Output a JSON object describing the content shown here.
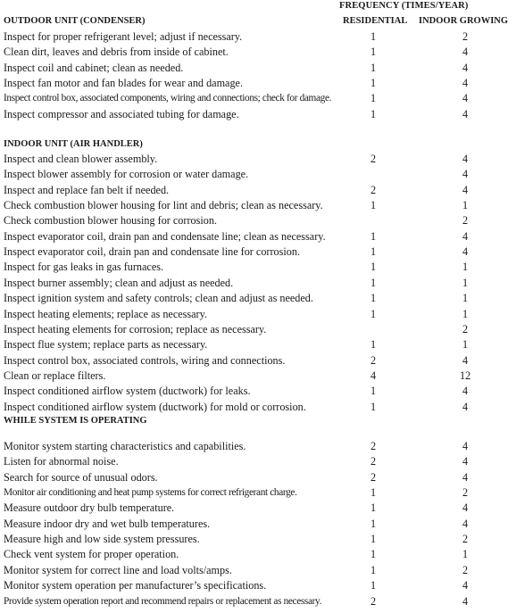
{
  "header": {
    "frequency_title": "FREQUENCY (TIMES/YEAR)",
    "col_residential": "RESIDENTIAL",
    "col_indoor_growing": "INDOOR GROWING"
  },
  "sections": [
    {
      "title": "OUTDOOR UNIT (CONDENSER)",
      "rows": [
        {
          "task": "Inspect for proper refrigerant level; adjust if necessary.",
          "residential": "1",
          "indoor_growing": "2"
        },
        {
          "task": "Clean dirt, leaves and debris from inside of cabinet.",
          "residential": "1",
          "indoor_growing": "4"
        },
        {
          "task": "Inspect coil and cabinet; clean as needed.",
          "residential": "1",
          "indoor_growing": "4"
        },
        {
          "task": "Inspect fan motor and fan blades for wear and damage.",
          "residential": "1",
          "indoor_growing": "4"
        },
        {
          "task": "Inspect control box, associated components, wiring and connections; check for damage.",
          "residential": "1",
          "indoor_growing": "4"
        },
        {
          "task": "Inspect compressor and associated tubing for damage.",
          "residential": "1",
          "indoor_growing": "4"
        }
      ]
    },
    {
      "title": "INDOOR UNIT (AIR HANDLER)",
      "rows": [
        {
          "task": "Inspect and clean blower assembly.",
          "residential": "2",
          "indoor_growing": "4"
        },
        {
          "task": "Inspect blower assembly for corrosion or water damage.",
          "residential": "",
          "indoor_growing": "4"
        },
        {
          "task": "Inspect and replace fan belt if needed.",
          "residential": "2",
          "indoor_growing": "4"
        },
        {
          "task": "Check combustion blower housing for lint and debris; clean as necessary.",
          "residential": "1",
          "indoor_growing": "1"
        },
        {
          "task": "Check combustion blower housing for corrosion.",
          "residential": "",
          "indoor_growing": "2"
        },
        {
          "task": "Inspect evaporator coil, drain pan and condensate line; clean as necessary.",
          "residential": "1",
          "indoor_growing": "4"
        },
        {
          "task": "Inspect evaporator coil, drain pan and condensate line for corrosion.",
          "residential": "1",
          "indoor_growing": "4"
        },
        {
          "task": "Inspect for gas leaks in gas furnaces.",
          "residential": "1",
          "indoor_growing": "1"
        },
        {
          "task": "Inspect burner assembly; clean and adjust as needed.",
          "residential": "1",
          "indoor_growing": "1"
        },
        {
          "task": "Inspect ignition system and safety controls; clean and adjust as needed.",
          "residential": "1",
          "indoor_growing": "1"
        },
        {
          "task": "Inspect heating elements; replace as necessary.",
          "residential": "1",
          "indoor_growing": "1"
        },
        {
          "task": "Inspect heating elements for corrosion; replace as necessary.",
          "residential": "",
          "indoor_growing": "2"
        },
        {
          "task": "Inspect flue system; replace parts as necessary.",
          "residential": "1",
          "indoor_growing": "1"
        },
        {
          "task": "Inspect control box, associated controls, wiring and connections.",
          "residential": "2",
          "indoor_growing": "4"
        },
        {
          "task": "Clean or replace filters.",
          "residential": "4",
          "indoor_growing": "12"
        },
        {
          "task": "Inspect conditioned airflow system (ductwork) for leaks.",
          "residential": "1",
          "indoor_growing": "4"
        },
        {
          "task": "Inspect conditioned airflow system (ductwork) for mold or corrosion.",
          "residential": "1",
          "indoor_growing": "4"
        }
      ]
    },
    {
      "title": "WHILE SYSTEM IS OPERATING",
      "rows": [
        {
          "task": "Monitor system starting characteristics and capabilities.",
          "residential": "2",
          "indoor_growing": "4"
        },
        {
          "task": "Listen for abnormal noise.",
          "residential": "2",
          "indoor_growing": "4"
        },
        {
          "task": "Search for source of unusual odors.",
          "residential": "2",
          "indoor_growing": "4"
        },
        {
          "task": "Monitor air conditioning and heat pump systems for correct refrigerant charge.",
          "residential": "1",
          "indoor_growing": "2"
        },
        {
          "task": "Measure outdoor dry bulb temperature.",
          "residential": "1",
          "indoor_growing": "4"
        },
        {
          "task": "Measure indoor dry and wet bulb temperatures.",
          "residential": "1",
          "indoor_growing": "4"
        },
        {
          "task": "Measure high and low side system pressures.",
          "residential": "1",
          "indoor_growing": "2"
        },
        {
          "task": "Check vent system for proper operation.",
          "residential": "1",
          "indoor_growing": "1"
        },
        {
          "task": "Monitor system for correct line and load volts/amps.",
          "residential": "1",
          "indoor_growing": "2"
        },
        {
          "task": "Monitor system operation per manufacturer’s specifications.",
          "residential": "1",
          "indoor_growing": "4"
        },
        {
          "task": "Provide system operation report and recommend repairs or replacement as necessary.",
          "residential": "2",
          "indoor_growing": "4"
        }
      ]
    }
  ]
}
